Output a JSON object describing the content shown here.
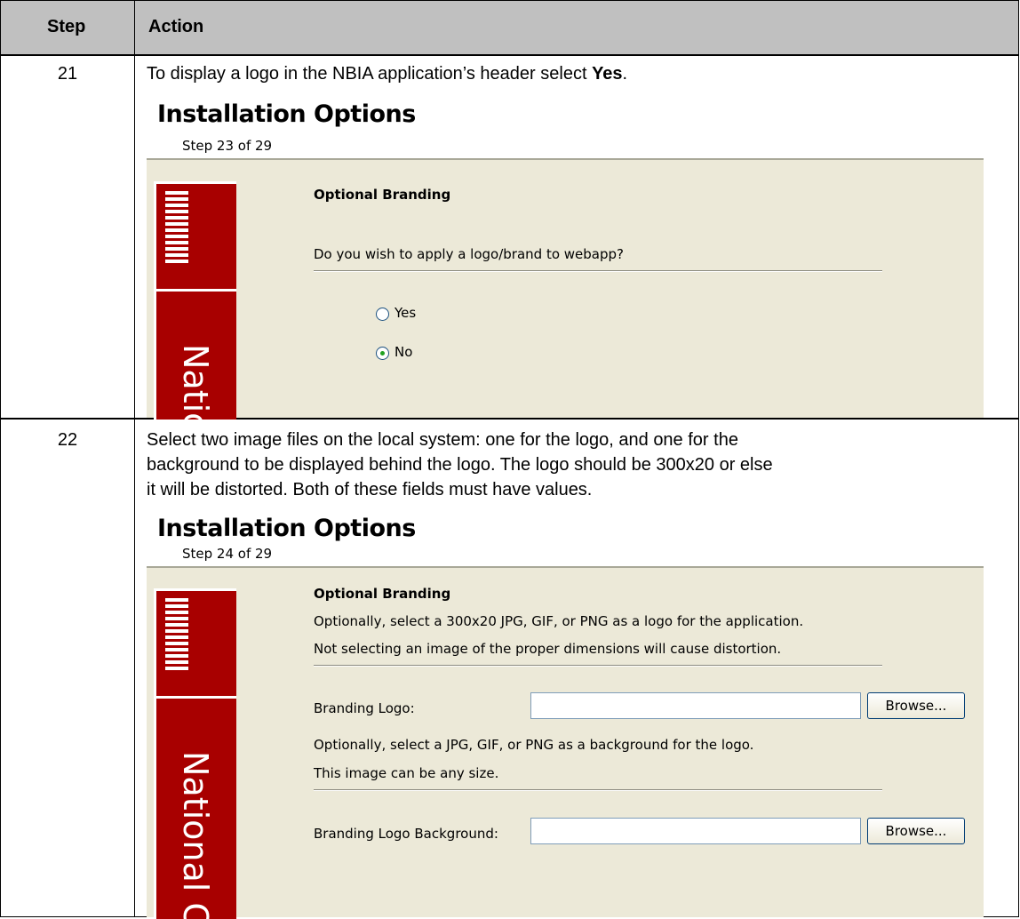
{
  "header": {
    "step": "Step",
    "action": "Action"
  },
  "rows": [
    {
      "step": "21",
      "text_before": "To display a logo in the NBIA application’s header select ",
      "text_bold": "Yes",
      "text_after": ".",
      "screen": {
        "title": "Installation Options",
        "step": "Step 23 of 29",
        "section": "Optional Branding",
        "question": "Do you wish to apply a logo/brand to webapp?",
        "options": [
          {
            "label": "Yes",
            "selected": false
          },
          {
            "label": "No",
            "selected": true
          }
        ],
        "brand_text": "Natic"
      }
    },
    {
      "step": "22",
      "lines": [
        "Select two image files on the local system: one for the logo, and one for the",
        "background to be displayed behind the logo.  The logo should be 300x20 or else",
        "it will be distorted.  Both of these fields must have values."
      ],
      "screen": {
        "title": "Installation Options",
        "step": "Step 24 of 29",
        "section": "Optional Branding",
        "desc1": "Optionally, select a 300x20 JPG, GIF, or PNG as a logo for the application.",
        "desc2": "Not selecting an image of the proper dimensions will cause distortion.",
        "logo_label": "Branding Logo:",
        "logo_value": "",
        "browse": "Browse...",
        "desc3": "Optionally, select a JPG, GIF, or PNG as a background for the logo.",
        "desc4": "This image can be any size.",
        "bg_label": "Branding Logo Background:",
        "bg_value": "",
        "brand_text": "National Ca"
      }
    }
  ],
  "brand_color": "#a80000",
  "panel_color": "#ece9d8",
  "brand_logo_text": "NATIONAL CANCER INSTITUTE"
}
